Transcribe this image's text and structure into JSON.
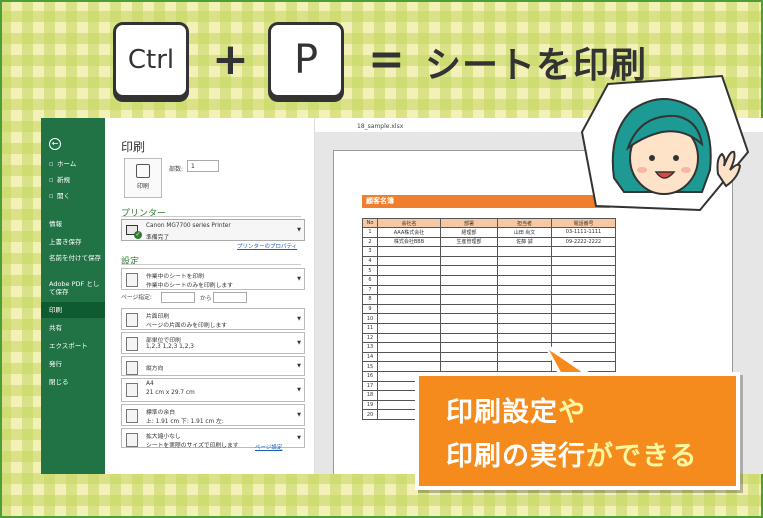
{
  "header": {
    "key_ctrl": "Ctrl",
    "plus": "+",
    "key_p": "P",
    "equals": "=",
    "headline": "シートを印刷"
  },
  "window": {
    "filename": "18_sample.xlsx",
    "signin_partial": "サイ"
  },
  "sidebar": {
    "items": [
      {
        "label": "ホーム",
        "icon": "home-icon"
      },
      {
        "label": "新規",
        "icon": "new-file-icon"
      },
      {
        "label": "開く",
        "icon": "open-folder-icon"
      },
      {
        "label": "情報"
      },
      {
        "label": "上書き保存"
      },
      {
        "label": "名前を付けて保存"
      },
      {
        "label": "Adobe PDF として保存"
      },
      {
        "label": "印刷",
        "active": true
      },
      {
        "label": "共有"
      },
      {
        "label": "エクスポート"
      },
      {
        "label": "発行"
      },
      {
        "label": "閉じる"
      }
    ]
  },
  "print_pane": {
    "title": "印刷",
    "print_button": "印刷",
    "copies_label": "部数:",
    "copies_value": "1",
    "printer_heading": "プリンター",
    "printer_name": "Canon MG7700 series Printer",
    "printer_status": "準備完了",
    "printer_properties_link": "プリンターのプロパティ",
    "settings_heading": "設定",
    "settings": [
      {
        "line1": "作業中のシートを印刷",
        "line2": "作業中のシートのみを印刷します"
      },
      {
        "line1": "片面印刷",
        "line2": "ページの片面のみを印刷します"
      },
      {
        "line1": "部単位で印刷",
        "line2": "1,2,3    1,2,3    1,2,3"
      },
      {
        "line1": "縦方向",
        "line2": ""
      },
      {
        "line1": "A4",
        "line2": "21 cm x 29.7 cm"
      },
      {
        "line1": "標準の余白",
        "line2": "上: 1.91 cm 下: 1.91 cm 左:"
      },
      {
        "line1": "拡大縮小なし",
        "line2": "シートを実際のサイズで印刷します"
      }
    ],
    "pages_label": "ページ指定:",
    "pages_to": "から",
    "page_setup_link": "ページ設定"
  },
  "preview": {
    "sheet_title": "顧客名簿",
    "columns": [
      "No",
      "会社名",
      "部署",
      "担当者",
      "電話番号"
    ],
    "rows": [
      [
        "1",
        "AAA株式会社",
        "経理部",
        "山田 尚文",
        "03-1111-1111"
      ],
      [
        "2",
        "株式会社BBB",
        "生産管理部",
        "佐藤 誠",
        "09-2222-2222"
      ],
      [
        "3",
        "",
        "",
        "",
        ""
      ],
      [
        "4",
        "",
        "",
        "",
        ""
      ],
      [
        "5",
        "",
        "",
        "",
        ""
      ],
      [
        "6",
        "",
        "",
        "",
        ""
      ],
      [
        "7",
        "",
        "",
        "",
        ""
      ],
      [
        "8",
        "",
        "",
        "",
        ""
      ],
      [
        "9",
        "",
        "",
        "",
        ""
      ],
      [
        "10",
        "",
        "",
        "",
        ""
      ],
      [
        "11",
        "",
        "",
        "",
        ""
      ],
      [
        "12",
        "",
        "",
        "",
        ""
      ],
      [
        "13",
        "",
        "",
        "",
        ""
      ],
      [
        "14",
        "",
        "",
        "",
        ""
      ],
      [
        "15",
        "",
        "",
        "",
        ""
      ],
      [
        "16",
        "",
        "",
        "",
        ""
      ],
      [
        "17",
        "",
        "",
        "",
        ""
      ],
      [
        "18",
        "",
        "",
        "",
        ""
      ],
      [
        "19",
        "",
        "",
        "",
        ""
      ],
      [
        "20",
        "",
        "",
        "",
        ""
      ]
    ]
  },
  "callout": {
    "line1_a": "印刷設定",
    "line1_b": "や",
    "line2_a": "印刷の実行",
    "line2_b": "ができる"
  },
  "colors": {
    "excel_green": "#217346",
    "accent_orange": "#f58b1c",
    "header_orange": "#ef7f2e",
    "plaid_green": "#c4d660"
  }
}
